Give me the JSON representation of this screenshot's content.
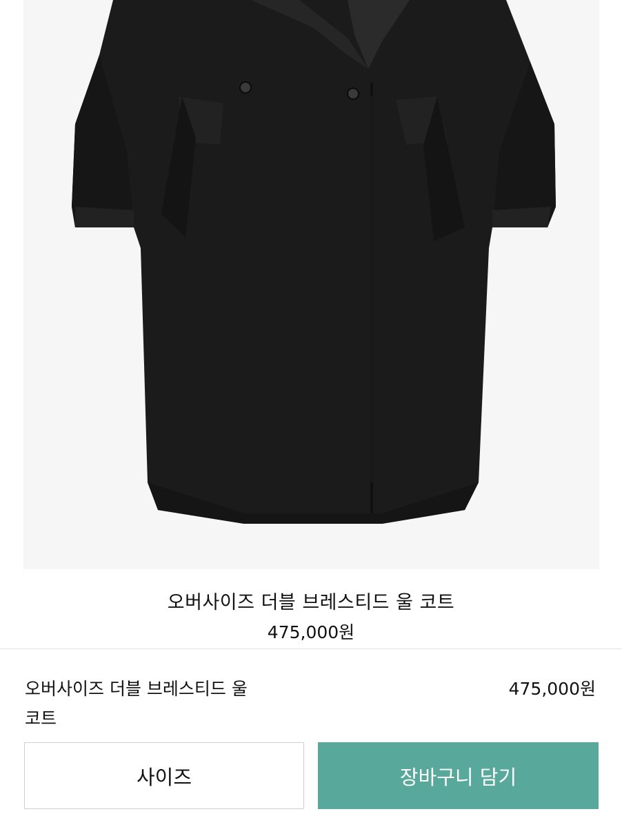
{
  "colors": {
    "image_background": "#f6f6f6",
    "coat": "#1a1a1a",
    "cart_button_bg": "#58a89b",
    "cart_button_text": "#ffffff",
    "divider": "#e2e2e2"
  },
  "product": {
    "image_icon": "black-coat-image",
    "name": "오버사이즈 더블 브레스티드 울 코트",
    "price": "475,000원"
  },
  "purchase_sheet": {
    "name_line1": "오버사이즈 더블 브레스티드 울",
    "name_line2": "코트",
    "price": "475,000원",
    "size_button_label": "사이즈",
    "cart_button_label": "장바구니 담기"
  }
}
